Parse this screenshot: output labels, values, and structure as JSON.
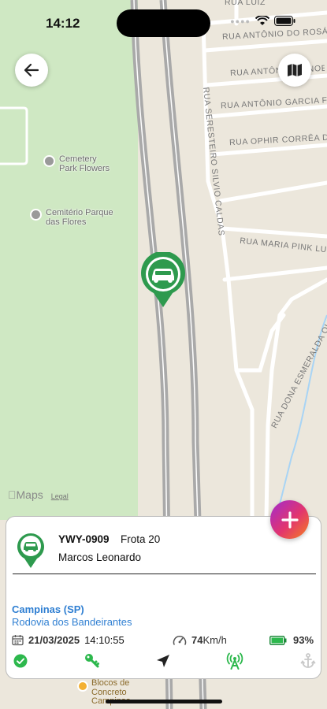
{
  "status_bar": {
    "time": "14:12"
  },
  "map": {
    "streets": [
      "RUA LUIZ",
      "RUA ANTÔNIO DO ROSÁRIO",
      "RUA ANTÔNIO MANOEL",
      "RUA ANTÔNIO GARCIA FERNANDES",
      "RUA OPHIR CORRÊA DE TOLEDO",
      "RUA SERESTEIRO SILVIO CALDAS",
      "RUA MARIA PINK LUÍS",
      "RUA DONA ESMERALDA OLIVEIRA MATHIAS"
    ],
    "pois": [
      {
        "name": "Cemetery Park Flowers",
        "line1": "Cemetery",
        "line2": "Park Flowers"
      },
      {
        "name": "Cemitério Parque das Flores",
        "line1": "Cemitério Parque",
        "line2": "das Flores"
      }
    ],
    "bottom_poi": {
      "line1": "Blocos de",
      "line2": "Concreto",
      "line3": "Campinas"
    },
    "attribution": {
      "logo": "Maps",
      "legal": "Legal"
    }
  },
  "vehicle": {
    "plate": "YWY-0909",
    "fleet": "Frota 20",
    "driver": "Marcos Leonardo",
    "city": "Campinas (SP)",
    "road": "Rodovia dos Bandeirantes",
    "date": "21/03/2025",
    "time": "14:10:55",
    "speed_value": "74",
    "speed_unit": "Km/h",
    "battery": "93%"
  },
  "colors": {
    "accent_green": "#2e9a4e",
    "link_blue": "#2f7fd2",
    "fab_gradient": [
      "#a12bd0",
      "#e2356e",
      "#f5801f"
    ],
    "park_green": "#cfe8c3"
  },
  "icons": {
    "back": "arrow-left-icon",
    "map_mode": "map-icon",
    "car_pin": "car-pin-icon",
    "add": "plus-icon",
    "status": "check-circle-icon",
    "ignition": "key-icon",
    "navigate": "location-arrow-icon",
    "signal": "antenna-icon",
    "anchor": "anchor-icon"
  }
}
